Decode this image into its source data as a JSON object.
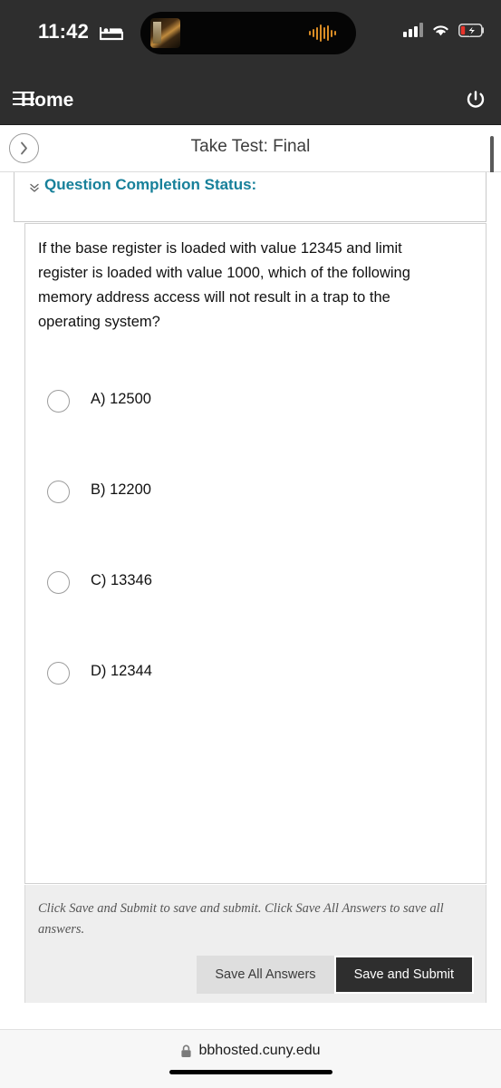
{
  "status_bar": {
    "time": "11:42",
    "bed_icon": "bed-icon",
    "dynamic_island": {
      "media_thumbnail": "album-art",
      "waveform_icon": "audio-waveform-icon",
      "waveform_bars": [
        5,
        9,
        14,
        19,
        13,
        17,
        8,
        5
      ]
    },
    "signal_icon": "cellular-signal-icon",
    "signal_bars": [
      6,
      9,
      12,
      16
    ],
    "signal_active": 3,
    "wifi_icon": "wifi-icon",
    "battery_icon": "battery-charging-icon",
    "battery_level_color": "#e8332a",
    "battery_charging": true
  },
  "app_nav": {
    "menu_icon": "hamburger-menu-icon",
    "home_label": "Home",
    "power_icon": "power-icon"
  },
  "page_header": {
    "back_icon": "chevron-right-circle-icon",
    "title": "Take Test: Final"
  },
  "completion_status": {
    "chevron_icon": "double-chevron-down-icon",
    "title": "Question Completion Status:",
    "accent_color": "#17809a"
  },
  "question": {
    "text": "If the base register is loaded with value 12345 and limit register is loaded with value 1000, which of the following memory address access will not result in a trap to the operating system?",
    "options": [
      {
        "label": "A) 12500",
        "selected": false
      },
      {
        "label": "B) 12200",
        "selected": false
      },
      {
        "label": "C) 13346",
        "selected": false
      },
      {
        "label": "D) 12344",
        "selected": false
      }
    ]
  },
  "footer": {
    "note": "Click Save and Submit to save and submit. Click Save All Answers to save all answers.",
    "save_all_label": "Save All Answers",
    "save_submit_label": "Save and Submit"
  },
  "browser_bar": {
    "lock_icon": "lock-icon",
    "url": "bbhosted.cuny.edu"
  }
}
